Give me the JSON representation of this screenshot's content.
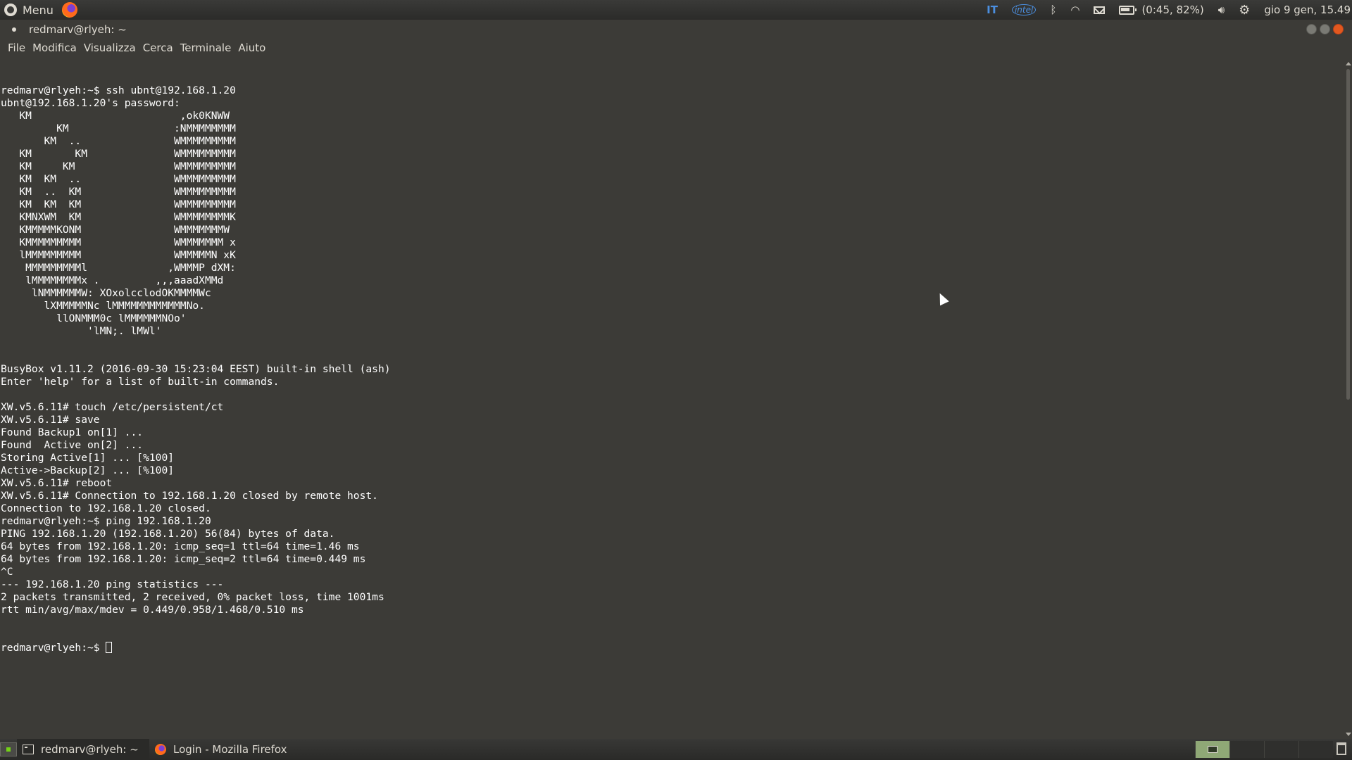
{
  "top_panel": {
    "menu_label": "Menu",
    "tray": {
      "keyboard_layout": "IT",
      "intel_label": "intel",
      "battery_text": "(0:45, 82%)",
      "datetime": "gio 9 gen, 15.49"
    }
  },
  "window": {
    "title": "redmarv@rlyeh: ~"
  },
  "menubar": {
    "items": [
      "File",
      "Modifica",
      "Visualizza",
      "Cerca",
      "Terminale",
      "Aiuto"
    ]
  },
  "terminal": {
    "lines": [
      "redmarv@rlyeh:~$ ssh ubnt@192.168.1.20",
      "ubnt@192.168.1.20's password:",
      "   KM                        ,ok0KNWW",
      "         KM                 :NMMMMMMMM",
      "       KM  ..               WMMMMMMMMM",
      "   KM       KM              WMMMMMMMMM",
      "   KM     KM                WMMMMMMMMM",
      "   KM  KM  ..               WMMMMMMMMM",
      "   KM  ..  KM               WMMMMMMMMM",
      "   KM  KM  KM               WMMMMMMMMM",
      "   KMNXWM  KM               WMMMMMMMMK",
      "   KMMMMMKONM               WMMMMMMMW",
      "   KMMMMMMMMM               WMMMMMMM x",
      "   lMMMMMMMMM               WMMMMMN xK",
      "    MMMMMMMMMl             ,WMMMP dXM:",
      "    lMMMMMMMMx .         ,,,aaadXMMd",
      "     lNMMMMMMW: XOxolcclodOKMMMMWc",
      "       lXMMMMMNc lMMMMMMMMMMMMNo.",
      "         llONMMM0c lMMMMMMNOo'",
      "              'lMN;. lMWl'",
      "",
      "",
      "BusyBox v1.11.2 (2016-09-30 15:23:04 EEST) built-in shell (ash)",
      "Enter 'help' for a list of built-in commands.",
      "",
      "XW.v5.6.11# touch /etc/persistent/ct",
      "XW.v5.6.11# save",
      "Found Backup1 on[1] ...",
      "Found  Active on[2] ...",
      "Storing Active[1] ... [%100]",
      "Active->Backup[2] ... [%100]",
      "XW.v5.6.11# reboot",
      "XW.v5.6.11# Connection to 192.168.1.20 closed by remote host.",
      "Connection to 192.168.1.20 closed.",
      "redmarv@rlyeh:~$ ping 192.168.1.20",
      "PING 192.168.1.20 (192.168.1.20) 56(84) bytes of data.",
      "64 bytes from 192.168.1.20: icmp_seq=1 ttl=64 time=1.46 ms",
      "64 bytes from 192.168.1.20: icmp_seq=2 ttl=64 time=0.449 ms",
      "^C",
      "--- 192.168.1.20 ping statistics ---",
      "2 packets transmitted, 2 received, 0% packet loss, time 1001ms",
      "rtt min/avg/max/mdev = 0.449/0.958/1.468/0.510 ms"
    ],
    "prompt": "redmarv@rlyeh:~$ "
  },
  "taskbar": {
    "tasks": [
      "redmarv@rlyeh: ~",
      "Login - Mozilla Firefox"
    ]
  },
  "colors": {
    "background": "#3c3b37",
    "text": "#ffffff",
    "close_button": "#e2581f",
    "active_workspace": "#8fa876"
  }
}
